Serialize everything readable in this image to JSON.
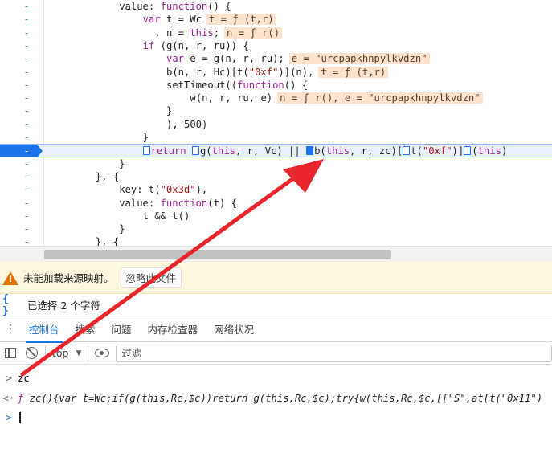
{
  "code": {
    "lines": [
      {
        "indent": 12,
        "parts": [
          {
            "t": "value: ",
            "c": ""
          },
          {
            "t": "function",
            "c": "kw"
          },
          {
            "t": "() {",
            "c": ""
          }
        ]
      },
      {
        "indent": 16,
        "parts": [
          {
            "t": "var",
            "c": "kw"
          },
          {
            "t": " t = Wc",
            "c": ""
          }
        ],
        "inline": "t = ƒ (t,r)"
      },
      {
        "indent": 18,
        "parts": [
          {
            "t": ", n = ",
            "c": ""
          },
          {
            "t": "this",
            "c": "kw"
          },
          {
            "t": ";",
            "c": ""
          }
        ],
        "inline": "n = ƒ r()"
      },
      {
        "indent": 16,
        "parts": [
          {
            "t": "if",
            "c": "kw"
          },
          {
            "t": " (g(n, r, ru)) {",
            "c": ""
          }
        ]
      },
      {
        "indent": 20,
        "parts": [
          {
            "t": "var",
            "c": "kw"
          },
          {
            "t": " e = g(n, r, ru);",
            "c": ""
          }
        ],
        "inline": "e = \"urcpapkhnpylkvdzn\""
      },
      {
        "indent": 20,
        "parts": [
          {
            "t": "b(n, r, Hc)[t(",
            "c": ""
          },
          {
            "t": "\"0xf\"",
            "c": "str"
          },
          {
            "t": ")](n),",
            "c": ""
          }
        ],
        "inline": "t = ƒ (t,r)"
      },
      {
        "indent": 20,
        "parts": [
          {
            "t": "setTimeout((",
            "c": ""
          },
          {
            "t": "function",
            "c": "kw"
          },
          {
            "t": "() {",
            "c": ""
          }
        ]
      },
      {
        "indent": 24,
        "parts": [
          {
            "t": "w(n, r, ru, e)",
            "c": ""
          }
        ],
        "inline": "n = ƒ r(), e = \"urcpapkhnpylkvdzn\""
      },
      {
        "indent": 20,
        "parts": [
          {
            "t": "}",
            "c": ""
          }
        ]
      },
      {
        "indent": 20,
        "parts": [
          {
            "t": "), 500)",
            "c": ""
          }
        ]
      },
      {
        "indent": 16,
        "parts": [
          {
            "t": "}",
            "c": ""
          }
        ]
      },
      {
        "indent": 16,
        "active": true,
        "parts": [
          {
            "t": "\u0001",
            "c": "bp"
          },
          {
            "t": "return",
            "c": "kw"
          },
          {
            "t": " ",
            "c": ""
          },
          {
            "t": "\u0001",
            "c": "bp"
          },
          {
            "t": "g(",
            "c": ""
          },
          {
            "t": "this",
            "c": "kw"
          },
          {
            "t": ", r, Vc) || ",
            "c": ""
          },
          {
            "t": "\u0002",
            "c": "bpf"
          },
          {
            "t": "b(",
            "c": ""
          },
          {
            "t": "this",
            "c": "kw"
          },
          {
            "t": ", r, zc)[",
            "c": ""
          },
          {
            "t": "\u0001",
            "c": "bp"
          },
          {
            "t": "t(",
            "c": ""
          },
          {
            "t": "\"0xf\"",
            "c": "str"
          },
          {
            "t": ")]",
            "c": ""
          },
          {
            "t": "\u0001",
            "c": "bp"
          },
          {
            "t": "(",
            "c": ""
          },
          {
            "t": "this",
            "c": "kw"
          },
          {
            "t": ")",
            "c": ""
          }
        ]
      },
      {
        "indent": 12,
        "parts": [
          {
            "t": "}",
            "c": ""
          }
        ]
      },
      {
        "indent": 8,
        "parts": [
          {
            "t": "}, {",
            "c": ""
          }
        ]
      },
      {
        "indent": 12,
        "parts": [
          {
            "t": "key: t(",
            "c": ""
          },
          {
            "t": "\"0x3d\"",
            "c": "str"
          },
          {
            "t": "),",
            "c": ""
          }
        ]
      },
      {
        "indent": 12,
        "parts": [
          {
            "t": "value: ",
            "c": ""
          },
          {
            "t": "function",
            "c": "kw"
          },
          {
            "t": "(t) {",
            "c": ""
          }
        ]
      },
      {
        "indent": 16,
        "parts": [
          {
            "t": "t && t()",
            "c": ""
          }
        ]
      },
      {
        "indent": 12,
        "parts": [
          {
            "t": "}",
            "c": ""
          }
        ]
      },
      {
        "indent": 8,
        "parts": [
          {
            "t": "}, {",
            "c": ""
          }
        ]
      }
    ],
    "gutter_mark": "-"
  },
  "warning": {
    "text": "未能加载来源映射。",
    "button": "忽略此文件"
  },
  "selection": {
    "icon": "{ }",
    "text": "已选择 2 个字符"
  },
  "tabs": [
    {
      "label": "控制台",
      "active": true
    },
    {
      "label": "搜索",
      "active": false
    },
    {
      "label": "问题",
      "active": false
    },
    {
      "label": "内存检查器",
      "active": false
    },
    {
      "label": "网络状况",
      "active": false
    }
  ],
  "toolbar": {
    "context": "top",
    "filter_placeholder": "过滤"
  },
  "console": {
    "input_prompt": ">",
    "input_text": "zc",
    "result_prompt": "<·",
    "result_f": "ƒ",
    "result_text": " zc(){var t=Wc;if(g(this,Rc,$c))return g(this,Rc,$c);try{w(this,Rc,$c,[[\"S\",at[t(\"0x11\")",
    "new_prompt": ">"
  },
  "colors": {
    "accent": "#1a73e8",
    "annotation_arrow": "#e8262b",
    "warning": "#e37400"
  }
}
